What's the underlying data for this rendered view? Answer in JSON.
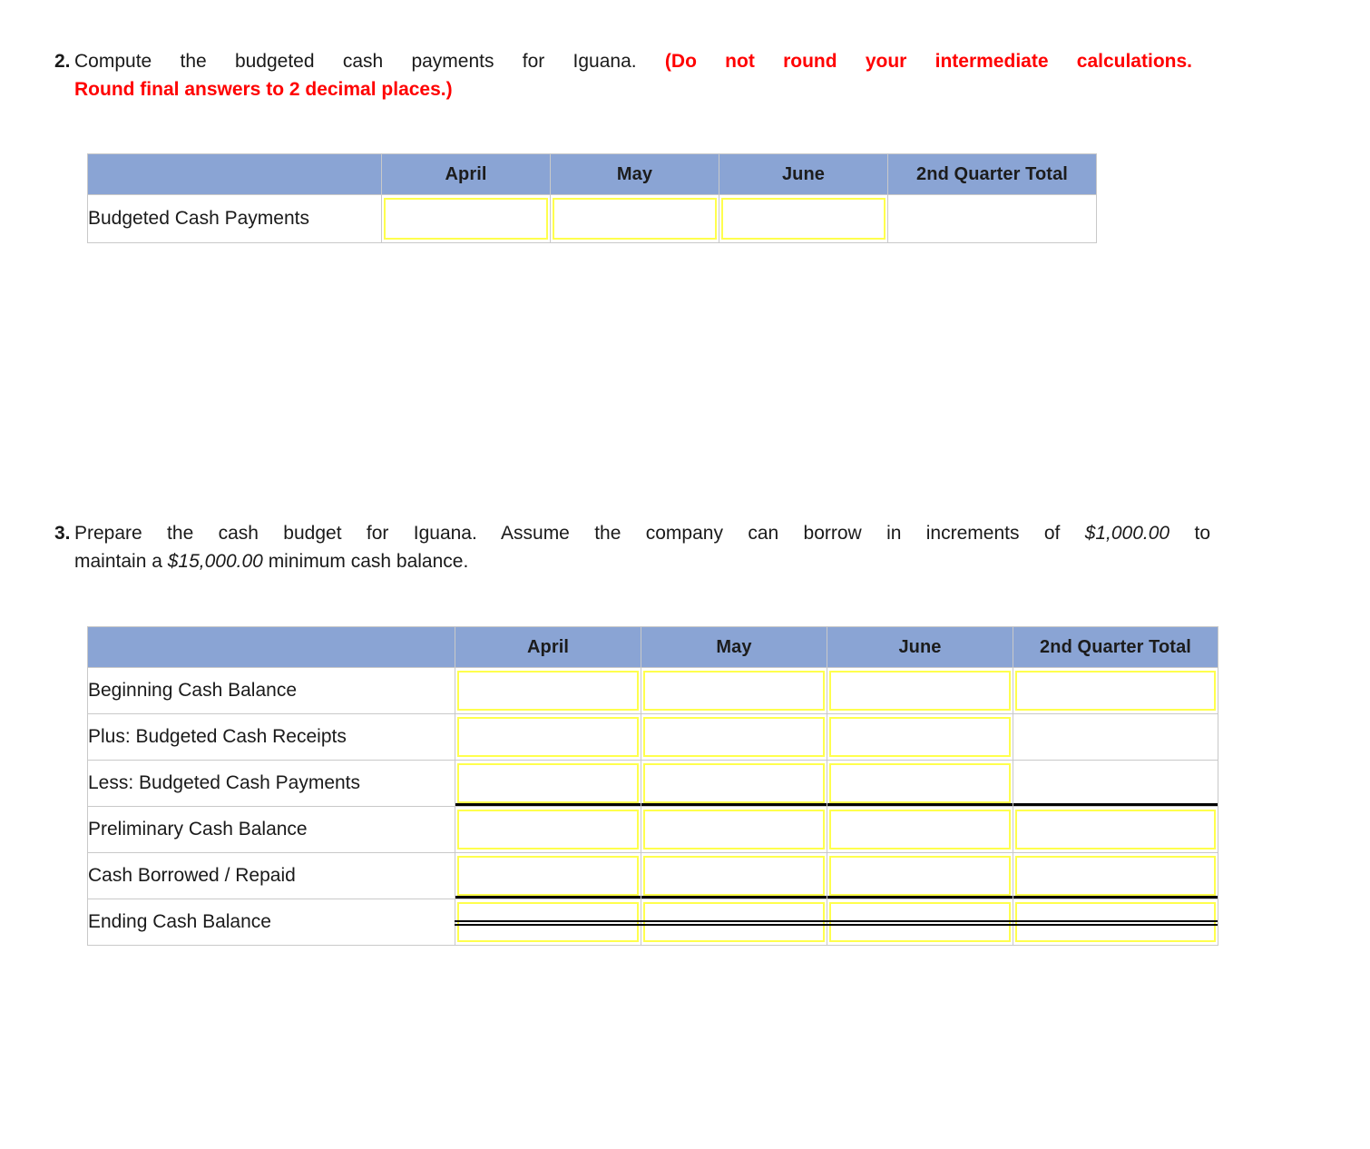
{
  "questions": [
    {
      "number": "2.",
      "line1_black": "Compute the budgeted cash payments for Iguana.",
      "line1_red": "(Do not round your intermediate calculations.",
      "line2_red": "Round final answers to 2 decimal places.)"
    },
    {
      "number": "3.",
      "line1_a": "Prepare the cash budget for Iguana. Assume the company can borrow in increments of",
      "line1_amount": "$1,000.00",
      "line1_b": "to",
      "line2_a": "maintain a",
      "line2_amount": "$15,000.00",
      "line2_b": "minimum cash balance."
    }
  ],
  "table1": {
    "name": "Budgeted Cash Payments",
    "headers": [
      "",
      "April",
      "May",
      "June",
      "2nd Quarter Total"
    ],
    "rows": [
      {
        "label": "Budgeted Cash Payments",
        "cells": [
          {
            "value": "",
            "input": true
          },
          {
            "value": "",
            "input": true
          },
          {
            "value": "",
            "input": true
          },
          {
            "value": "",
            "input": false
          }
        ]
      }
    ]
  },
  "table2": {
    "name": "Cash Budget",
    "headers": [
      "",
      "April",
      "May",
      "June",
      "2nd Quarter Total"
    ],
    "rows": [
      {
        "label": "Beginning Cash Balance",
        "cells": [
          {
            "value": "",
            "input": true
          },
          {
            "value": "",
            "input": true
          },
          {
            "value": "",
            "input": true
          },
          {
            "value": "",
            "input": true
          }
        ]
      },
      {
        "label": "Plus: Budgeted Cash Receipts",
        "cells": [
          {
            "value": "",
            "input": true
          },
          {
            "value": "",
            "input": true
          },
          {
            "value": "",
            "input": true
          },
          {
            "value": "",
            "input": false
          }
        ]
      },
      {
        "label": "Less: Budgeted Cash Payments",
        "cells": [
          {
            "value": "",
            "input": true
          },
          {
            "value": "",
            "input": true
          },
          {
            "value": "",
            "input": true
          },
          {
            "value": "",
            "input": false
          }
        ]
      },
      {
        "label": "Preliminary Cash Balance",
        "cells": [
          {
            "value": "",
            "input": true
          },
          {
            "value": "",
            "input": true
          },
          {
            "value": "",
            "input": true
          },
          {
            "value": "",
            "input": true
          }
        ]
      },
      {
        "label": "Cash Borrowed / Repaid",
        "cells": [
          {
            "value": "",
            "input": true
          },
          {
            "value": "",
            "input": true
          },
          {
            "value": "",
            "input": true
          },
          {
            "value": "",
            "input": true
          }
        ]
      },
      {
        "label": "Ending Cash Balance",
        "cells": [
          {
            "value": "",
            "input": true
          },
          {
            "value": "",
            "input": true
          },
          {
            "value": "",
            "input": true
          },
          {
            "value": "",
            "input": true
          }
        ]
      }
    ]
  },
  "colors": {
    "header_blue": "#8aa4d4",
    "input_border_yellow": "#ffff4d",
    "instruction_red": "#ff0000",
    "grid_gray": "#c9c9c9",
    "rule_black": "#000000"
  }
}
